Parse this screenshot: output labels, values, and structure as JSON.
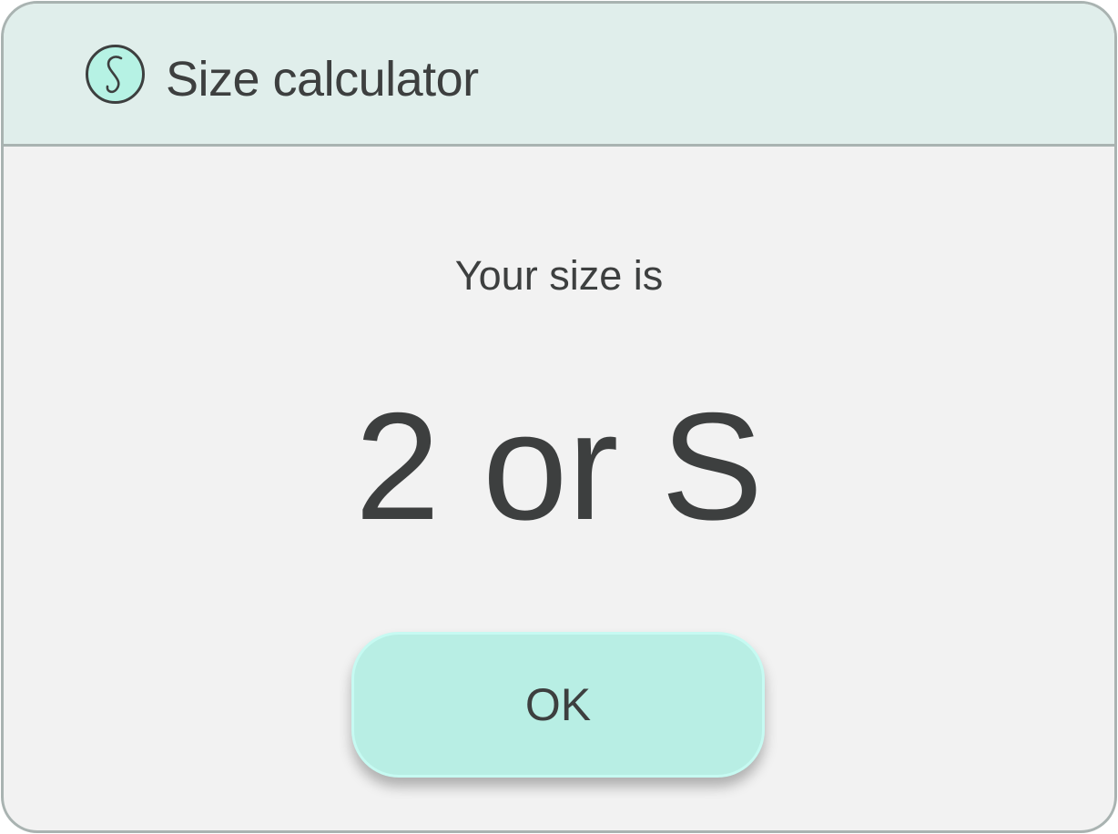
{
  "window": {
    "title": "Size calculator",
    "icon": "s-logo-icon",
    "accent": "#b8eee4",
    "titlebar_color": "#e0eeeb"
  },
  "content": {
    "prompt": "Your size is",
    "result": "2 or S"
  },
  "actions": {
    "ok_label": "OK"
  }
}
